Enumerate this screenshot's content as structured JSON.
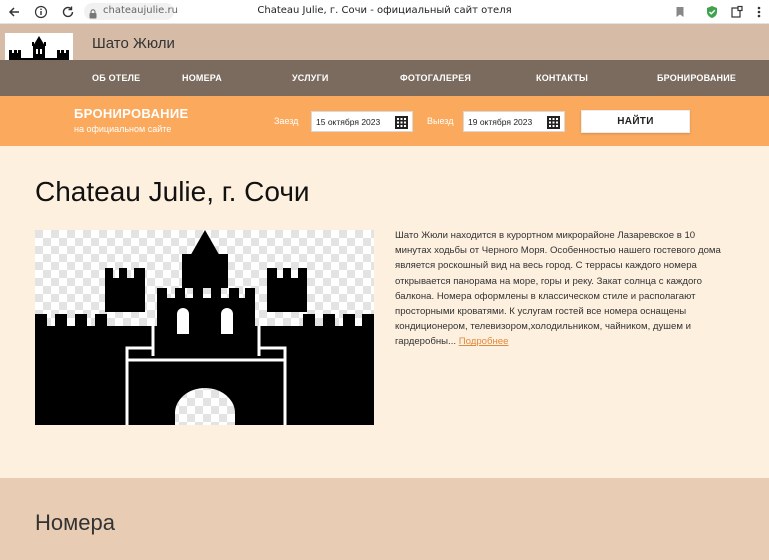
{
  "browser": {
    "url": "chateaujulie.ru",
    "tab_title": "Chateau Julie, г. Сочи - официальный сайт отеля"
  },
  "header": {
    "site_title": "Шато Жюли"
  },
  "nav": {
    "items": [
      {
        "label": "ОБ ОТЕЛЕ"
      },
      {
        "label": "НОМЕРА"
      },
      {
        "label": "УСЛУГИ"
      },
      {
        "label": "ФОТОГАЛЕРЕЯ"
      },
      {
        "label": "КОНТАКТЫ"
      },
      {
        "label": "БРОНИРОВАНИЕ"
      }
    ]
  },
  "booking": {
    "title": "БРОНИРОВАНИЕ",
    "subtitle": "на официальном сайте",
    "checkin_label": "Заезд",
    "checkin_value": "15 октября 2023",
    "checkout_label": "Выезд",
    "checkout_value": "19 октября 2023",
    "search_label": "НАЙТИ"
  },
  "main": {
    "heading": "Chateau Julie, г. Сочи",
    "intro_text": "Шато Жюли находится в курортном микрорайоне Лазаревское в 10 минутах ходьбы от Черного Моря. Особенностью нашего гостевого дома является роскошный вид на весь город. С террасы каждого номера открывается панорама на море, горы и реку. Закат солнца с каждого балкона. Номера оформлены в классическом стиле и располагают просторными кроватями. К услугам гостей все номера оснащены кондиционером, телевизором,холодильником, чайником, душем и гардеробны...",
    "more_link": "Подробнее"
  },
  "rooms": {
    "heading": "Номера"
  },
  "colors": {
    "header_bg": "#d6bca7",
    "nav_bg": "#7a6b5e",
    "booking_bg": "#fba95c",
    "page_bg": "#fdf0df",
    "link": "#e08a3c"
  },
  "icons": [
    "back-arrow-icon",
    "info-icon",
    "reload-icon",
    "lock-icon",
    "bookmark-icon",
    "shield-icon",
    "extension-icon",
    "menu-icon",
    "calendar-icon",
    "castle-logo"
  ]
}
